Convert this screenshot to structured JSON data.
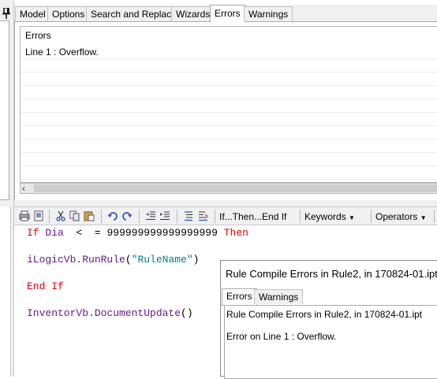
{
  "top_tabs": [
    {
      "label": "Model",
      "active": false
    },
    {
      "label": "Options",
      "active": false
    },
    {
      "label": "Search and Replace",
      "active": false
    },
    {
      "label": "Wizards",
      "active": false
    },
    {
      "label": "Errors",
      "active": true
    },
    {
      "label": "Warnings",
      "active": false
    }
  ],
  "errors_panel": {
    "header": "Errors",
    "rows": [
      "Line 1 : Overflow."
    ]
  },
  "toolbar": {
    "icons": [
      "print-icon",
      "print-preview-icon",
      "cut-icon",
      "copy-icon",
      "paste-icon",
      "undo-icon",
      "redo-icon",
      "decrease-indent-icon",
      "increase-indent-icon",
      "comment-icon",
      "uncomment-icon"
    ],
    "menus": [
      {
        "label": "If...Then...End If",
        "dropdown": false
      },
      {
        "label": "Keywords",
        "dropdown": true
      },
      {
        "label": "Operators",
        "dropdown": true
      }
    ]
  },
  "code": {
    "line1": {
      "kw_if": "If",
      "var": "Dia",
      "op": "<  =",
      "num": "999999999999999999",
      "kw_then": "Then"
    },
    "line2": {
      "obj": "iLogicVb.RunRule",
      "open": "(",
      "arg": "\"RuleName\"",
      "close": ")"
    },
    "line3": {
      "kw": "End If"
    },
    "line4": {
      "obj": "InventorVb.DocumentUpdate",
      "parens": "()"
    }
  },
  "dialog": {
    "title": "Rule Compile Errors in Rule2, in 170824-01.ipt",
    "tabs": [
      {
        "label": "Errors",
        "active": true
      },
      {
        "label": "Warnings",
        "active": false
      }
    ],
    "body_line1": "Rule Compile Errors in Rule2, in 170824-01.ipt",
    "body_line2": "Error on Line 1 : Overflow."
  },
  "colors": {
    "keyword": "#e00000",
    "function": "#6a1a8f",
    "string": "#008080",
    "toolbar_bg": "#f0f0f0"
  }
}
